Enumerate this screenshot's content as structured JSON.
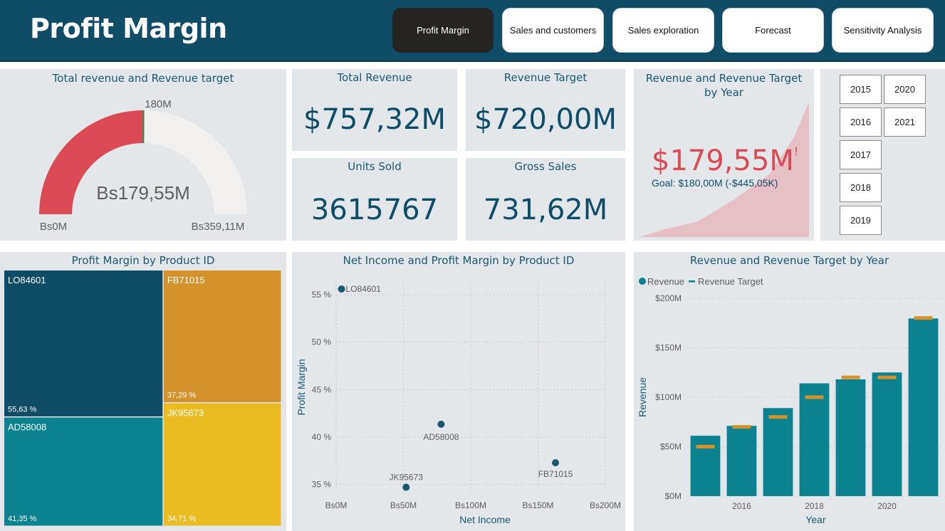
{
  "header": {
    "title": "Profit Margin",
    "nav": [
      "Profit Margin",
      "Sales and customers",
      "Sales exploration",
      "Forecast",
      "Sensitivity Analysis"
    ],
    "active_index": 0
  },
  "gauge": {
    "title": "Total revenue and Revenue target",
    "value_label": "Bs179,55M",
    "target_label": "180M",
    "min_label": "Bs0M",
    "max_label": "Bs359,11M",
    "value": 179.55,
    "target": 180,
    "min": 0,
    "max": 359.11,
    "fill_color": "#dc4a55",
    "track_color": "#f2f1f0",
    "target_color": "#2e8b57"
  },
  "kpis": {
    "total_revenue": {
      "label": "Total Revenue",
      "value": "$757,32M"
    },
    "revenue_target": {
      "label": "Revenue Target",
      "value": "$720,00M"
    },
    "units_sold": {
      "label": "Units Sold",
      "value": "3615767"
    },
    "gross_sales": {
      "label": "Gross Sales",
      "value": "731,62M"
    }
  },
  "revenue_card": {
    "title": "Revenue and Revenue Target by Year",
    "value": "$179,55M",
    "indicator": "!",
    "goal": "Goal: $180,00M (-$445,05K)",
    "value_color": "#dc4a55"
  },
  "year_slicer": [
    "2015",
    "2020",
    "2016",
    "2021",
    "2017",
    "2018",
    "2019"
  ],
  "chart_data": [
    {
      "type": "gauge",
      "title": "Total revenue and Revenue target",
      "value": 179.55,
      "target": 180,
      "min": 0,
      "max": 359.11,
      "unit": "M"
    },
    {
      "type": "treemap",
      "title": "Profit Margin by Product ID",
      "items": [
        {
          "name": "LO84601",
          "value": 55.63,
          "label": "55,63 %",
          "color": "#0e4c67"
        },
        {
          "name": "FB71015",
          "value": 37.29,
          "label": "37,29 %",
          "color": "#d4922b"
        },
        {
          "name": "AD58008",
          "value": 41.35,
          "label": "41,35 %",
          "color": "#0a8290"
        },
        {
          "name": "JK95673",
          "value": 34.71,
          "label": "34,71 %",
          "color": "#ebbb22"
        }
      ]
    },
    {
      "type": "scatter",
      "title": "Net Income and Profit Margin by Product ID",
      "xlabel": "Net Income",
      "ylabel": "Profit Margin",
      "xlim": [
        0,
        200
      ],
      "ylim": [
        34,
        56.5
      ],
      "xticks": [
        0,
        50,
        100,
        150,
        200
      ],
      "xtick_labels": [
        "Bs0M",
        "Bs50M",
        "Bs100M",
        "Bs150M",
        "Bs200M"
      ],
      "yticks": [
        35,
        40,
        45,
        50,
        55
      ],
      "ytick_labels": [
        "35 %",
        "40 %",
        "45 %",
        "50 %",
        "55 %"
      ],
      "points": [
        {
          "name": "LO84601",
          "x": 4,
          "y": 55.6
        },
        {
          "name": "AD58008",
          "x": 78,
          "y": 41.35
        },
        {
          "name": "FB71015",
          "x": 163,
          "y": 37.29
        },
        {
          "name": "JK95673",
          "x": 52,
          "y": 34.71
        }
      ],
      "point_color": "#1c5770"
    },
    {
      "type": "bar",
      "title": "Revenue and Revenue Target by Year",
      "xlabel": "Year",
      "ylabel": "Revenue",
      "categories": [
        "2015",
        "2016",
        "2017",
        "2018",
        "2019",
        "2020",
        "2021"
      ],
      "xtick_labels": [
        "",
        "2016",
        "",
        "2018",
        "",
        "2020",
        ""
      ],
      "ylim": [
        0,
        200
      ],
      "yticks": [
        0,
        50,
        100,
        150,
        200
      ],
      "ytick_labels": [
        "$0M",
        "$50M",
        "$100M",
        "$150M",
        "$200M"
      ],
      "legend": "top-left",
      "series": [
        {
          "name": "Revenue",
          "values": [
            61,
            71,
            89,
            114,
            118,
            125,
            179.55
          ],
          "color": "#0a8290"
        },
        {
          "name": "Revenue Target",
          "values": [
            50,
            70,
            80,
            100,
            120,
            120,
            180
          ],
          "color": "#d4922b"
        }
      ]
    }
  ]
}
